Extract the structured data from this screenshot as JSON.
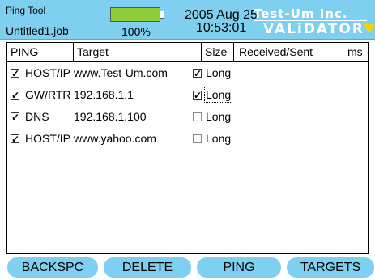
{
  "header": {
    "app_title": "Ping Tool",
    "file_name": "Untitled1.job",
    "battery_label": "100%",
    "battery_level": 1.0,
    "date": "2005 Aug 25",
    "time": "10:53:01",
    "brand_name": "Test-Um Inc.",
    "product_name": "VALiDATOR",
    "colors": {
      "header_bg": "#7fd0f0",
      "battery_green": "#8fce3a",
      "brand_accent": "#f5d400"
    }
  },
  "table": {
    "columns": {
      "ping": "PING",
      "target": "Target",
      "size": "Size",
      "received_sent": "Received/Sent",
      "ms": "ms"
    },
    "rows": [
      {
        "ping_checked": true,
        "type": "HOST/IP",
        "target": "www.Test-Um.com",
        "size_checked": true,
        "size_label": "Long"
      },
      {
        "ping_checked": true,
        "type": "GW/RTR",
        "target": "192.168.1.1",
        "size_checked": true,
        "size_label": "Long"
      },
      {
        "ping_checked": true,
        "type": "DNS",
        "target": "192.168.1.100",
        "size_checked": false,
        "size_label": "Long"
      },
      {
        "ping_checked": true,
        "type": "HOST/IP",
        "target": "www.yahoo.com",
        "size_checked": false,
        "size_label": "Long"
      }
    ]
  },
  "buttons": {
    "backspc": "BACKSPC",
    "delete": "DELETE",
    "ping": "PING",
    "targets": "TARGETS"
  }
}
